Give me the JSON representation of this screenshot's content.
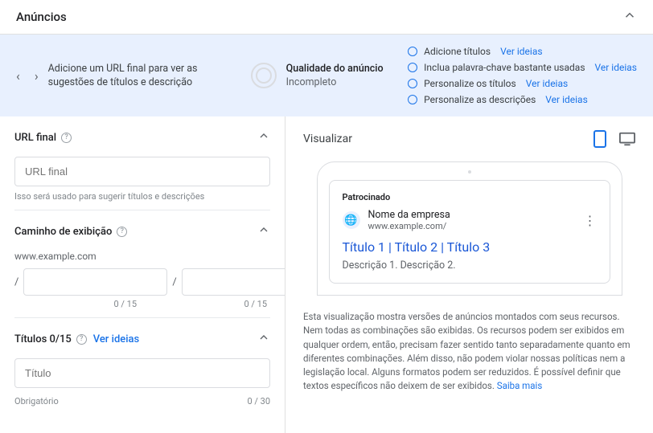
{
  "header": {
    "title": "Anúncios"
  },
  "banner": {
    "message": "Adicione um URL final para ver as sugestões de títulos e descrição",
    "quality_label": "Qualidade do anúncio",
    "quality_status": "Incompleto"
  },
  "checklist": [
    {
      "label": "Adicione títulos",
      "link": "Ver ideias"
    },
    {
      "label": "Inclua palavra-chave bastante usadas",
      "link": "Ver ideias"
    },
    {
      "label": "Personalize os títulos",
      "link": "Ver ideias"
    },
    {
      "label": "Personalize as descrições",
      "link": "Ver ideias"
    }
  ],
  "left": {
    "final_url": {
      "title": "URL final",
      "placeholder": "URL final",
      "hint": "Isso será usado para sugerir títulos e descrições"
    },
    "display_path": {
      "title": "Caminho de exibição",
      "domain": "www.example.com",
      "counter1": "0 / 15",
      "counter2": "0 / 15"
    },
    "headlines": {
      "title": "Títulos 0/15",
      "ideas": "Ver ideias",
      "placeholder": "Título",
      "required": "Obrigatório",
      "counter": "0 / 30"
    }
  },
  "preview": {
    "title": "Visualizar",
    "sponsored": "Patrocinado",
    "company": "Nome da empresa",
    "url": "www.example.com/",
    "headline": "Título 1 | Título 2 | Título 3",
    "description": "Descrição 1. Descrição 2.",
    "disclaimer": "Esta visualização mostra versões de anúncios montados com seus recursos. Nem todas as combinações são exibidas. Os recursos podem ser exibidos em qualquer ordem, então, precisam fazer sentido tanto separadamente quanto em diferentes combinações. Além disso, não podem violar nossas políticas nem a legislação local. Alguns formatos podem ser reduzidos. É possível definir que textos específicos não deixem de ser exibidos. ",
    "learn_more": "Saiba mais"
  }
}
